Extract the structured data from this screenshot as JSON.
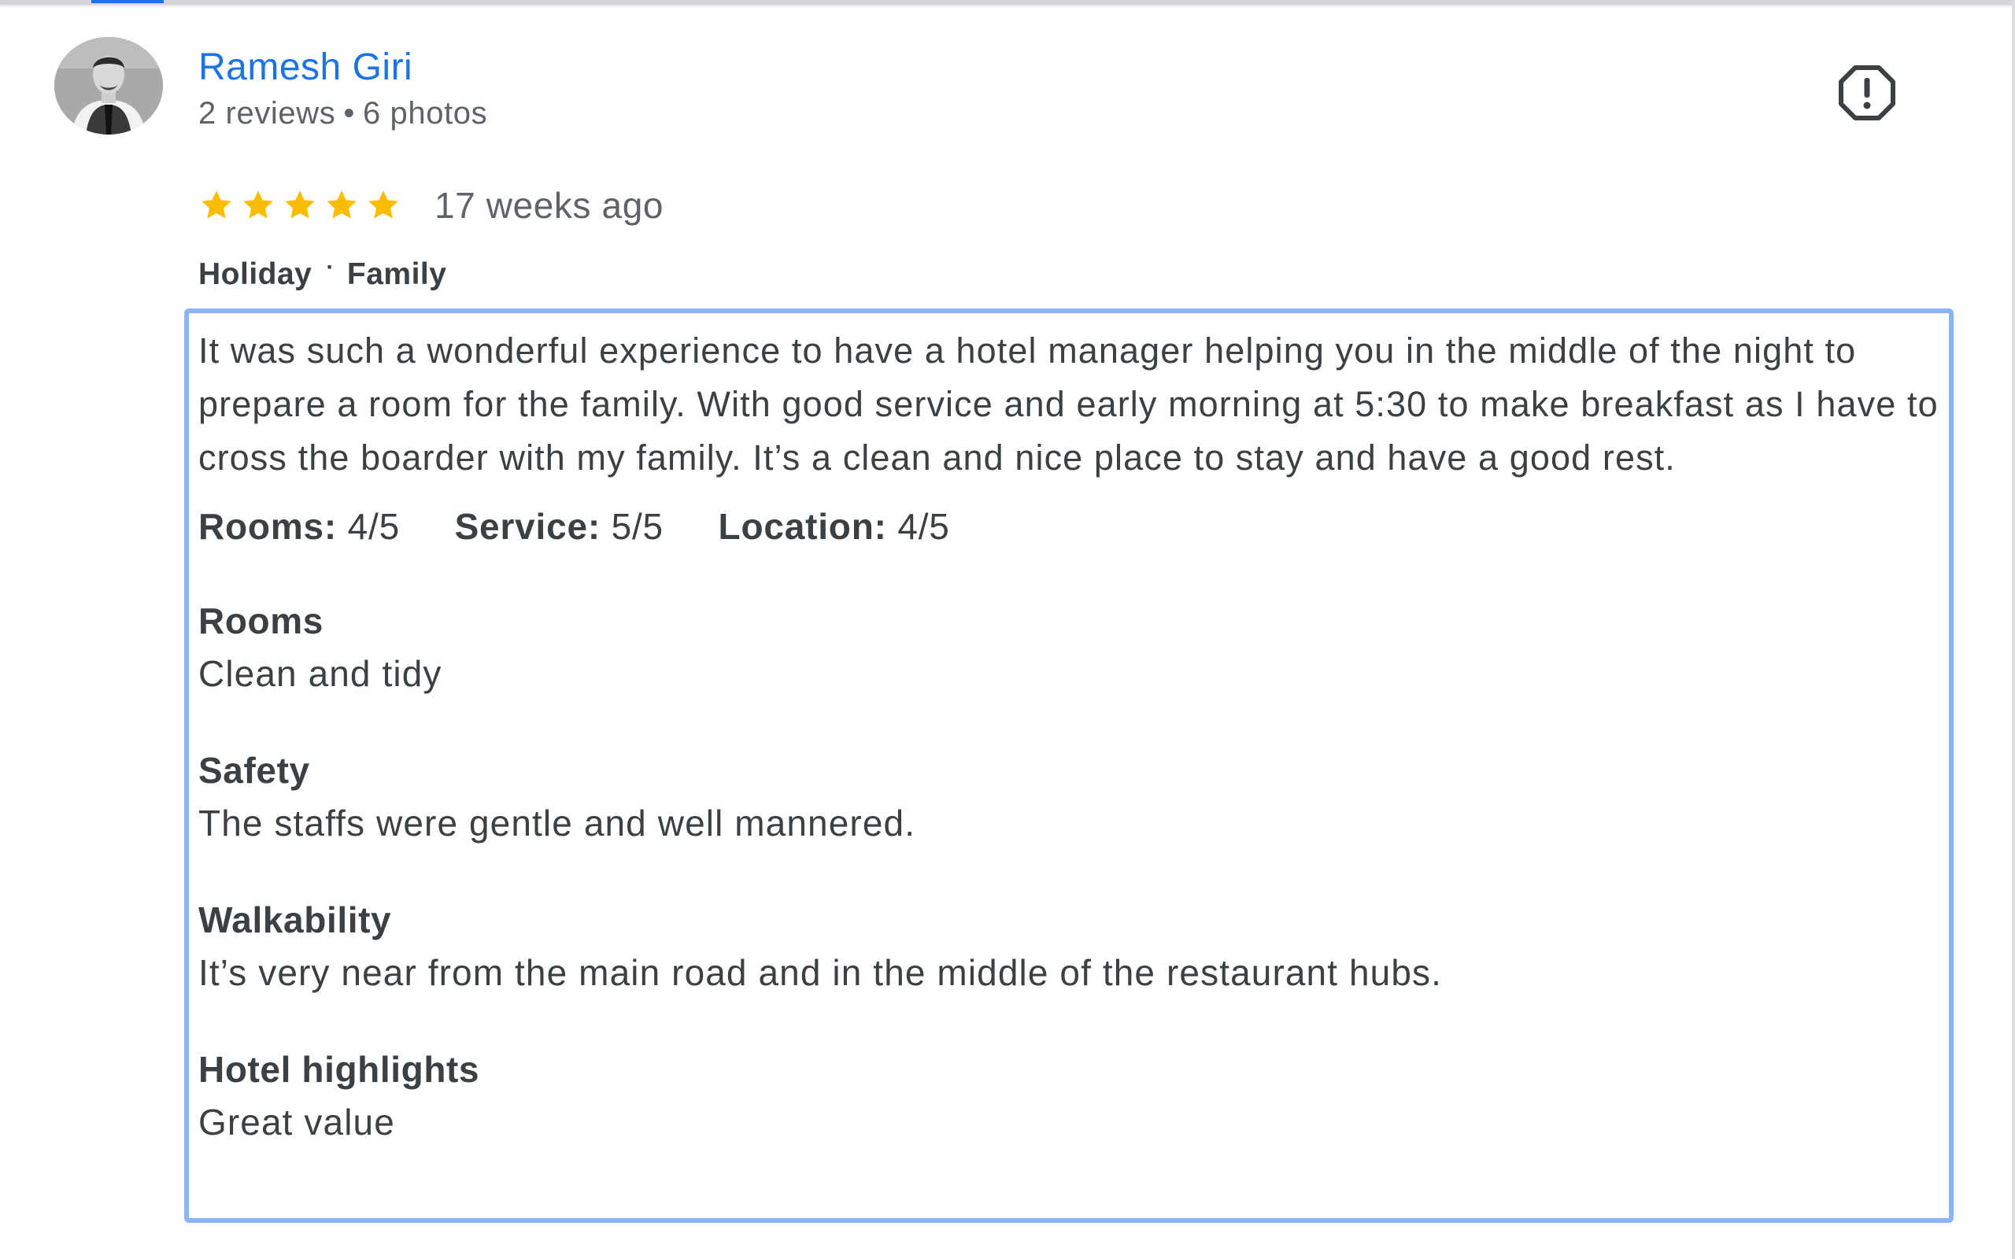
{
  "review": {
    "reviewer": {
      "name": "Ramesh Giri",
      "reviews": "2 reviews",
      "separator": "•",
      "photos": "6 photos"
    },
    "rating": {
      "stars": 5,
      "max": 5
    },
    "time_ago": "17 weeks ago",
    "trip": {
      "type": "Holiday",
      "separator": "·",
      "group": "Family"
    },
    "text": "It was such a wonderful experience to have a hotel manager helping you in the middle of the night to prepare a room for the family. With good service and early morning at 5:30 to make breakfast as I have to cross the boarder with my family. It’s a clean and nice place to stay and have a good rest.",
    "sub_ratings": [
      {
        "label": "Rooms:",
        "value": "4/5"
      },
      {
        "label": "Service:",
        "value": "5/5"
      },
      {
        "label": "Location:",
        "value": "4/5"
      }
    ],
    "sections": [
      {
        "title": "Rooms",
        "body": "Clean and tidy"
      },
      {
        "title": "Safety",
        "body": "The staffs were gentle and well mannered."
      },
      {
        "title": "Walkability",
        "body": "It’s very near from the main road and in the middle of the restaurant hubs."
      },
      {
        "title": "Hotel highlights",
        "body": "Great value"
      }
    ]
  },
  "icons": {
    "report": "report-flag-icon",
    "star": "star-icon",
    "avatar": "avatar"
  },
  "colors": {
    "link": "#1a73e8",
    "star": "#fbbc04",
    "focus_border": "#8ab4f8",
    "secondary_text": "#5f6368",
    "primary_text": "#3c4043"
  }
}
